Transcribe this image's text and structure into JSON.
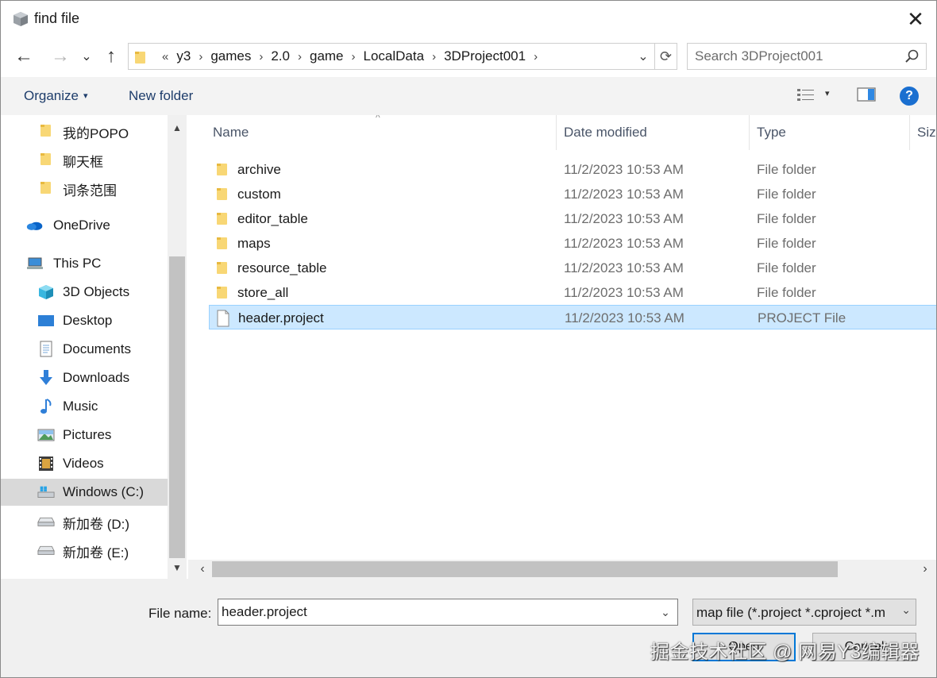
{
  "window": {
    "title": "find file",
    "close_glyph": "✕"
  },
  "nav": {
    "back_glyph": "←",
    "forward_glyph": "→",
    "recent_glyph": "⌄",
    "up_glyph": "↑"
  },
  "address": {
    "overflow": "«",
    "breadcrumbs": [
      "y3",
      "games",
      "2.0",
      "game",
      "LocalData",
      "3DProject001"
    ],
    "separator": "›",
    "dropdown_glyph": "⌄",
    "refresh_glyph": "⟳"
  },
  "search": {
    "placeholder": "Search 3DProject001"
  },
  "toolbar": {
    "organize": "Organize",
    "organize_caret": "▾",
    "new_folder": "New folder",
    "view_caret": "▾",
    "help": "?"
  },
  "sidebar": {
    "items": [
      {
        "label": "我的POPO",
        "icon": "folder-icon"
      },
      {
        "label": "聊天框",
        "icon": "folder-icon"
      },
      {
        "label": "词条范围",
        "icon": "folder-icon"
      },
      {
        "label": "OneDrive",
        "icon": "onedrive-icon"
      },
      {
        "label": "This PC",
        "icon": "pc-icon"
      },
      {
        "label": "3D Objects",
        "icon": "3d-objects-icon"
      },
      {
        "label": "Desktop",
        "icon": "desktop-icon"
      },
      {
        "label": "Documents",
        "icon": "documents-icon"
      },
      {
        "label": "Downloads",
        "icon": "downloads-icon"
      },
      {
        "label": "Music",
        "icon": "music-icon"
      },
      {
        "label": "Pictures",
        "icon": "pictures-icon"
      },
      {
        "label": "Videos",
        "icon": "videos-icon"
      },
      {
        "label": "Windows (C:)",
        "icon": "drive-c-icon"
      },
      {
        "label": "新加卷 (D:)",
        "icon": "drive-icon"
      },
      {
        "label": "新加卷 (E:)",
        "icon": "drive-icon"
      }
    ],
    "scroll_up": "▲",
    "scroll_down": "▼"
  },
  "columns": {
    "name": "Name",
    "date": "Date modified",
    "type": "Type",
    "size": "Size",
    "sort_arrow": "^"
  },
  "files": [
    {
      "name": "archive",
      "date": "11/2/2023 10:53 AM",
      "type": "File folder",
      "kind": "folder"
    },
    {
      "name": "custom",
      "date": "11/2/2023 10:53 AM",
      "type": "File folder",
      "kind": "folder"
    },
    {
      "name": "editor_table",
      "date": "11/2/2023 10:53 AM",
      "type": "File folder",
      "kind": "folder"
    },
    {
      "name": "maps",
      "date": "11/2/2023 10:53 AM",
      "type": "File folder",
      "kind": "folder"
    },
    {
      "name": "resource_table",
      "date": "11/2/2023 10:53 AM",
      "type": "File folder",
      "kind": "folder"
    },
    {
      "name": "store_all",
      "date": "11/2/2023 10:53 AM",
      "type": "File folder",
      "kind": "folder"
    },
    {
      "name": "header.project",
      "date": "11/2/2023 10:53 AM",
      "type": "PROJECT File",
      "kind": "file",
      "selected": true
    }
  ],
  "hscroll": {
    "left": "‹",
    "right": "›"
  },
  "bottom": {
    "file_name_label": "File name:",
    "file_name_value": "header.project",
    "file_name_dropdown": "⌄",
    "filter_value": "map file (*.project *.cproject *.m",
    "filter_dropdown": "⌄",
    "open_label": "Open",
    "cancel_label": "Cancel",
    "watermark": "掘金技术社区 @ 网易Y3编辑器"
  },
  "colors": {
    "selection_bg": "#cce8ff",
    "selection_border": "#99d1ff",
    "nav_selected_bg": "#d9d9d9",
    "folder_yellow": "#f8d775",
    "help_blue": "#1a6fd0"
  }
}
